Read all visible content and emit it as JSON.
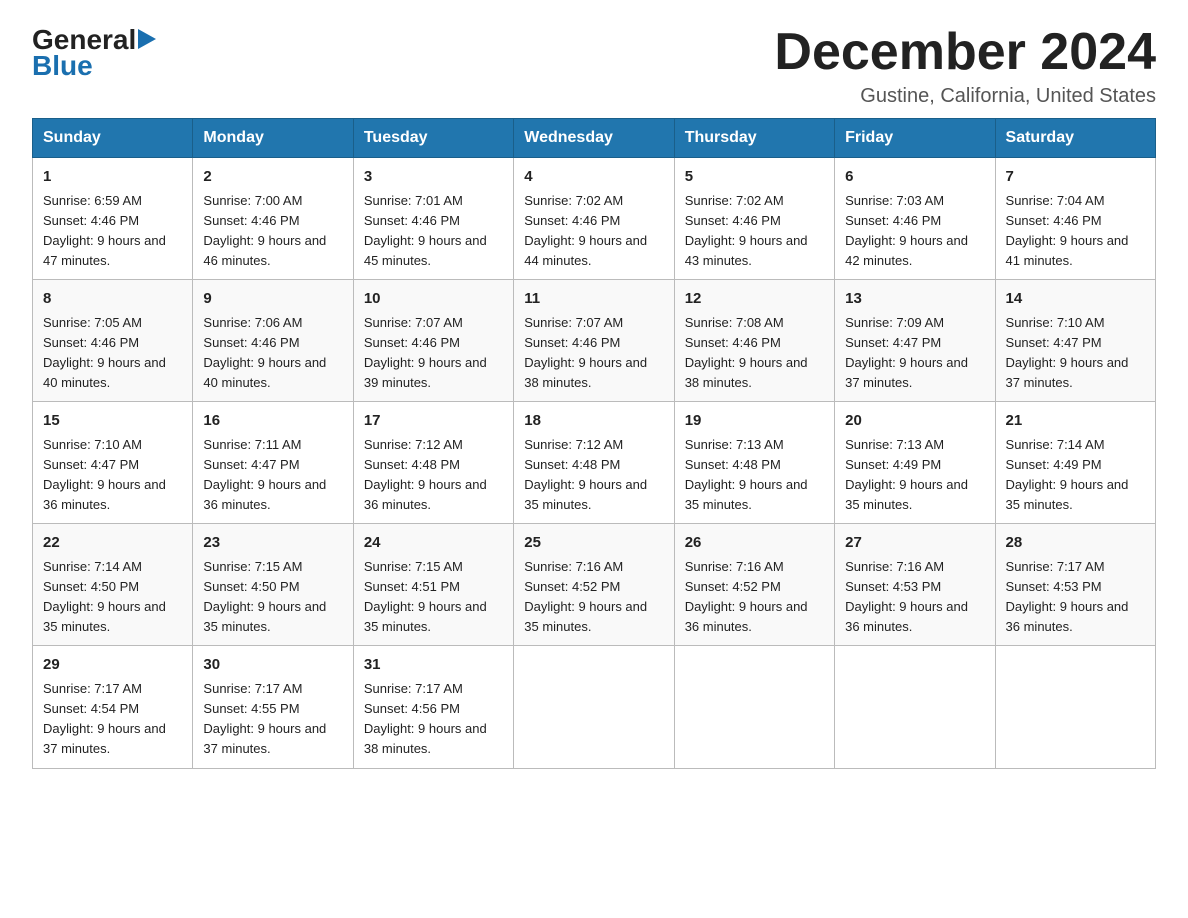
{
  "header": {
    "logo_general": "General",
    "logo_blue": "Blue",
    "month_title": "December 2024",
    "location": "Gustine, California, United States"
  },
  "days_of_week": [
    "Sunday",
    "Monday",
    "Tuesday",
    "Wednesday",
    "Thursday",
    "Friday",
    "Saturday"
  ],
  "weeks": [
    [
      {
        "day": "1",
        "sunrise": "Sunrise: 6:59 AM",
        "sunset": "Sunset: 4:46 PM",
        "daylight": "Daylight: 9 hours and 47 minutes."
      },
      {
        "day": "2",
        "sunrise": "Sunrise: 7:00 AM",
        "sunset": "Sunset: 4:46 PM",
        "daylight": "Daylight: 9 hours and 46 minutes."
      },
      {
        "day": "3",
        "sunrise": "Sunrise: 7:01 AM",
        "sunset": "Sunset: 4:46 PM",
        "daylight": "Daylight: 9 hours and 45 minutes."
      },
      {
        "day": "4",
        "sunrise": "Sunrise: 7:02 AM",
        "sunset": "Sunset: 4:46 PM",
        "daylight": "Daylight: 9 hours and 44 minutes."
      },
      {
        "day": "5",
        "sunrise": "Sunrise: 7:02 AM",
        "sunset": "Sunset: 4:46 PM",
        "daylight": "Daylight: 9 hours and 43 minutes."
      },
      {
        "day": "6",
        "sunrise": "Sunrise: 7:03 AM",
        "sunset": "Sunset: 4:46 PM",
        "daylight": "Daylight: 9 hours and 42 minutes."
      },
      {
        "day": "7",
        "sunrise": "Sunrise: 7:04 AM",
        "sunset": "Sunset: 4:46 PM",
        "daylight": "Daylight: 9 hours and 41 minutes."
      }
    ],
    [
      {
        "day": "8",
        "sunrise": "Sunrise: 7:05 AM",
        "sunset": "Sunset: 4:46 PM",
        "daylight": "Daylight: 9 hours and 40 minutes."
      },
      {
        "day": "9",
        "sunrise": "Sunrise: 7:06 AM",
        "sunset": "Sunset: 4:46 PM",
        "daylight": "Daylight: 9 hours and 40 minutes."
      },
      {
        "day": "10",
        "sunrise": "Sunrise: 7:07 AM",
        "sunset": "Sunset: 4:46 PM",
        "daylight": "Daylight: 9 hours and 39 minutes."
      },
      {
        "day": "11",
        "sunrise": "Sunrise: 7:07 AM",
        "sunset": "Sunset: 4:46 PM",
        "daylight": "Daylight: 9 hours and 38 minutes."
      },
      {
        "day": "12",
        "sunrise": "Sunrise: 7:08 AM",
        "sunset": "Sunset: 4:46 PM",
        "daylight": "Daylight: 9 hours and 38 minutes."
      },
      {
        "day": "13",
        "sunrise": "Sunrise: 7:09 AM",
        "sunset": "Sunset: 4:47 PM",
        "daylight": "Daylight: 9 hours and 37 minutes."
      },
      {
        "day": "14",
        "sunrise": "Sunrise: 7:10 AM",
        "sunset": "Sunset: 4:47 PM",
        "daylight": "Daylight: 9 hours and 37 minutes."
      }
    ],
    [
      {
        "day": "15",
        "sunrise": "Sunrise: 7:10 AM",
        "sunset": "Sunset: 4:47 PM",
        "daylight": "Daylight: 9 hours and 36 minutes."
      },
      {
        "day": "16",
        "sunrise": "Sunrise: 7:11 AM",
        "sunset": "Sunset: 4:47 PM",
        "daylight": "Daylight: 9 hours and 36 minutes."
      },
      {
        "day": "17",
        "sunrise": "Sunrise: 7:12 AM",
        "sunset": "Sunset: 4:48 PM",
        "daylight": "Daylight: 9 hours and 36 minutes."
      },
      {
        "day": "18",
        "sunrise": "Sunrise: 7:12 AM",
        "sunset": "Sunset: 4:48 PM",
        "daylight": "Daylight: 9 hours and 35 minutes."
      },
      {
        "day": "19",
        "sunrise": "Sunrise: 7:13 AM",
        "sunset": "Sunset: 4:48 PM",
        "daylight": "Daylight: 9 hours and 35 minutes."
      },
      {
        "day": "20",
        "sunrise": "Sunrise: 7:13 AM",
        "sunset": "Sunset: 4:49 PM",
        "daylight": "Daylight: 9 hours and 35 minutes."
      },
      {
        "day": "21",
        "sunrise": "Sunrise: 7:14 AM",
        "sunset": "Sunset: 4:49 PM",
        "daylight": "Daylight: 9 hours and 35 minutes."
      }
    ],
    [
      {
        "day": "22",
        "sunrise": "Sunrise: 7:14 AM",
        "sunset": "Sunset: 4:50 PM",
        "daylight": "Daylight: 9 hours and 35 minutes."
      },
      {
        "day": "23",
        "sunrise": "Sunrise: 7:15 AM",
        "sunset": "Sunset: 4:50 PM",
        "daylight": "Daylight: 9 hours and 35 minutes."
      },
      {
        "day": "24",
        "sunrise": "Sunrise: 7:15 AM",
        "sunset": "Sunset: 4:51 PM",
        "daylight": "Daylight: 9 hours and 35 minutes."
      },
      {
        "day": "25",
        "sunrise": "Sunrise: 7:16 AM",
        "sunset": "Sunset: 4:52 PM",
        "daylight": "Daylight: 9 hours and 35 minutes."
      },
      {
        "day": "26",
        "sunrise": "Sunrise: 7:16 AM",
        "sunset": "Sunset: 4:52 PM",
        "daylight": "Daylight: 9 hours and 36 minutes."
      },
      {
        "day": "27",
        "sunrise": "Sunrise: 7:16 AM",
        "sunset": "Sunset: 4:53 PM",
        "daylight": "Daylight: 9 hours and 36 minutes."
      },
      {
        "day": "28",
        "sunrise": "Sunrise: 7:17 AM",
        "sunset": "Sunset: 4:53 PM",
        "daylight": "Daylight: 9 hours and 36 minutes."
      }
    ],
    [
      {
        "day": "29",
        "sunrise": "Sunrise: 7:17 AM",
        "sunset": "Sunset: 4:54 PM",
        "daylight": "Daylight: 9 hours and 37 minutes."
      },
      {
        "day": "30",
        "sunrise": "Sunrise: 7:17 AM",
        "sunset": "Sunset: 4:55 PM",
        "daylight": "Daylight: 9 hours and 37 minutes."
      },
      {
        "day": "31",
        "sunrise": "Sunrise: 7:17 AM",
        "sunset": "Sunset: 4:56 PM",
        "daylight": "Daylight: 9 hours and 38 minutes."
      },
      null,
      null,
      null,
      null
    ]
  ]
}
